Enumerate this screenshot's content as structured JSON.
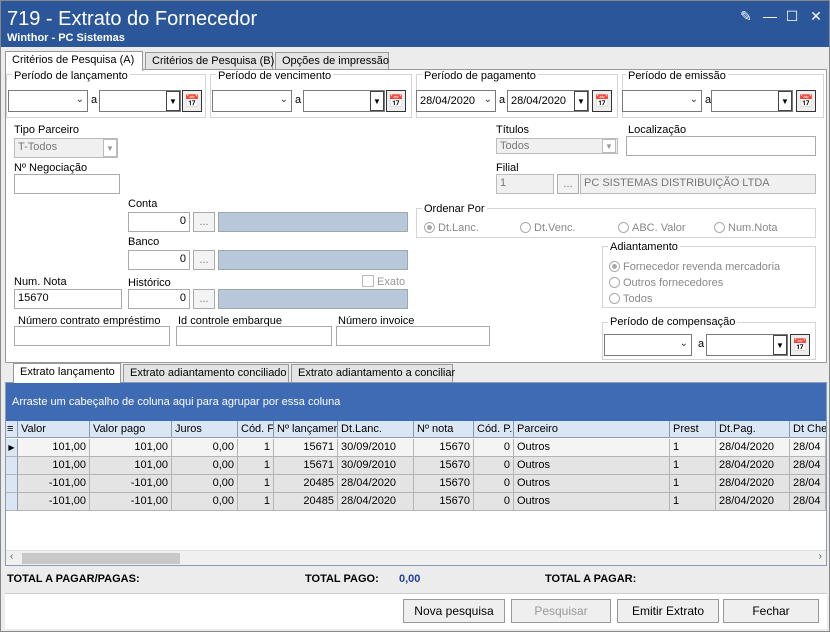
{
  "window": {
    "title": "719 - Extrato do Fornecedor",
    "subtitle": "Winthor - PC Sistemas"
  },
  "tabs_top": [
    "Critérios de Pesquisa (A)",
    "Critérios de Pesquisa (B)",
    "Opções de impressão"
  ],
  "filters": {
    "periodo_lancamento": {
      "label": "Período de lançamento",
      "from": "",
      "to": "",
      "sep": "a"
    },
    "periodo_vencimento": {
      "label": "Período de vencimento",
      "from": "",
      "to": "",
      "sep": "a"
    },
    "periodo_pagamento": {
      "label": "Período de pagamento",
      "from": "28/04/2020",
      "to": "28/04/2020",
      "sep": "a"
    },
    "periodo_emissao": {
      "label": "Período de emissão",
      "from": "",
      "to": "",
      "sep": "a"
    },
    "tipo_parceiro": {
      "label": "Tipo Parceiro",
      "value": "T-Todos"
    },
    "titulos": {
      "label": "Títulos",
      "value": "Todos"
    },
    "localizacao": {
      "label": "Localização",
      "value": ""
    },
    "num_negociacao": {
      "label": "Nº Negociação",
      "value": ""
    },
    "filial": {
      "label": "Filial",
      "code": "1",
      "name": "PC SISTEMAS DISTRIBUIÇÃO LTDA"
    },
    "conta": {
      "label": "Conta",
      "value": "0"
    },
    "banco": {
      "label": "Banco",
      "value": "0"
    },
    "historico": {
      "label": "Histórico",
      "value": "0"
    },
    "num_nota": {
      "label": "Num. Nota",
      "value": "15670"
    },
    "exato": {
      "label": "Exato"
    },
    "ordenar_por": {
      "label": "Ordenar Por",
      "options": [
        "Dt.Lanc.",
        "Dt.Venc.",
        "ABC. Valor",
        "Num.Nota"
      ],
      "selected": "Dt.Lanc."
    },
    "adiantamento": {
      "label": "Adiantamento",
      "options": [
        "Fornecedor revenda mercadoria",
        "Outros fornecedores",
        "Todos"
      ],
      "selected": "Fornecedor revenda mercadoria"
    },
    "numero_contrato": {
      "label": "Número contrato empréstimo",
      "value": ""
    },
    "id_controle": {
      "label": "Id controle embarque",
      "value": ""
    },
    "numero_invoice": {
      "label": "Número invoice",
      "value": ""
    },
    "periodo_compensacao": {
      "label": "Período de compensação",
      "from": "",
      "to": "",
      "sep": "a"
    }
  },
  "tabs_bottom": [
    "Extrato lançamento",
    "Extrato adiantamento conciliado",
    "Extrato adiantamento a conciliar"
  ],
  "grid": {
    "group_hint": "Arraste um cabeçalho de coluna aqui para agrupar por essa coluna",
    "columns": [
      "Valor",
      "Valor pago",
      "Juros",
      "Cód. Fi",
      "Nº lançamen",
      "Dt.Lanc.",
      "Nº nota",
      "Cód. P.",
      "Parceiro",
      "Prest",
      "Dt.Pag.",
      "Dt Che"
    ],
    "rows": [
      [
        "101,00",
        "101,00",
        "0,00",
        "1",
        "15671",
        "30/09/2010",
        "15670",
        "0",
        "Outros",
        "1",
        "28/04/2020",
        "28/04"
      ],
      [
        "101,00",
        "101,00",
        "0,00",
        "1",
        "15671",
        "30/09/2010",
        "15670",
        "0",
        "Outros",
        "1",
        "28/04/2020",
        "28/04"
      ],
      [
        "-101,00",
        "-101,00",
        "0,00",
        "1",
        "20485",
        "28/04/2020",
        "15670",
        "0",
        "Outros",
        "1",
        "28/04/2020",
        "28/04"
      ],
      [
        "-101,00",
        "-101,00",
        "0,00",
        "1",
        "20485",
        "28/04/2020",
        "15670",
        "0",
        "Outros",
        "1",
        "28/04/2020",
        "28/04"
      ]
    ]
  },
  "totals": {
    "total_pagar_pagas": "TOTAL A PAGAR/PAGAS:",
    "total_pago_label": "TOTAL PAGO:",
    "total_pago_value": "0,00",
    "total_a_pagar": "TOTAL A PAGAR:"
  },
  "buttons": {
    "nova_pesquisa": "Nova pesquisa",
    "pesquisar": "Pesquisar",
    "emitir_extrato": "Emitir Extrato",
    "fechar": "Fechar"
  },
  "colors": {
    "title_bar": "#2b579a",
    "grid_group_bar": "#3e6bb4",
    "total_value": "#1f3fa0"
  }
}
